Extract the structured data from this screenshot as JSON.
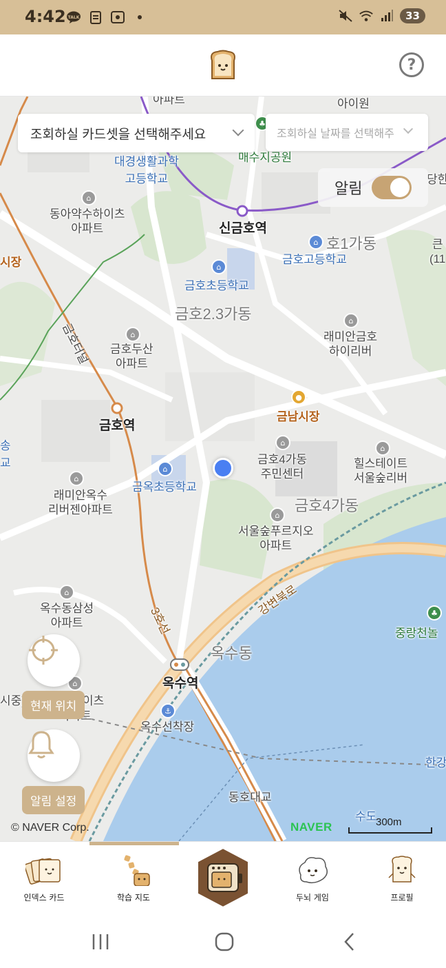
{
  "status_bar": {
    "time": "4:42",
    "battery": "33",
    "icons_left": [
      "talk-icon",
      "clipboard-icon",
      "screenshot-icon",
      "dot-icon"
    ],
    "icons_right": [
      "mute-icon",
      "wifi-icon",
      "signal-icon"
    ],
    "bg_color": "#d7bf97"
  },
  "header": {
    "logo": "toast-logo-icon",
    "help_label": "?"
  },
  "filters": {
    "cardset_placeholder": "조회하실 카드셋을 선택해주세요",
    "date_placeholder": "조회하실 날짜를 선택해주"
  },
  "alarm_toggle": {
    "label": "알림",
    "on": true
  },
  "map": {
    "labels": {
      "apt_top": "아파트",
      "aiwon": "아이원",
      "daegyeong": "대경생활과학\n고등학교",
      "maesu": "매수지공원",
      "dongah": "동아약수하이츠\n아파트",
      "singeum": "신금호역",
      "ho1": "호1가동",
      "geumho_hs": "금호고등학교",
      "sijang_left": "시장",
      "geumho_es": "금호초등학교",
      "ho23": "금호2.3가동",
      "tunnel": "금호터널",
      "geumho_doosan": "금호두산\n아파트",
      "raemian_geumho": "래미안금호\n하이리버",
      "geumnam": "금남시장",
      "geumho_stn": "금호역",
      "geumho4_center": "금호4가동\n주민센터",
      "hills": "힐스테이트\n서울숲리버",
      "geumok_es": "금옥초등학교",
      "raemian_oksu": "래미안옥수\n리버젠아파트",
      "ho4": "금호4가동",
      "seoulsup": "서울숲푸르지오\n아파트",
      "gangbyeon": "강변북로",
      "line3": "3호선",
      "oksu_samsung": "옥수동삼성\n아파트",
      "jungnang": "중랑천놀",
      "oksudong": "옥수동",
      "oksu_stn": "옥수역",
      "oksu_ferry": "옥수선착장",
      "dongho": "동호대교",
      "hangang": "한강",
      "sudo": "수도",
      "apt_heights": "이츠",
      "apt_heights2": "아파트",
      "soong_left": "송\n교",
      "dang": "당한",
      "keun": "큰\n(11",
      "sijung": "시중)"
    },
    "credit": "© NAVER Corp.",
    "naver": "NAVER",
    "scale": "300m"
  },
  "controls": {
    "current_location": "현재 위치",
    "alarm_settings": "알림 설정"
  },
  "bottom_nav": {
    "items": [
      {
        "label": "인덱스 카드",
        "icon": "index-card-icon"
      },
      {
        "label": "학습 지도",
        "icon": "learning-map-icon"
      },
      {
        "label": "",
        "icon": "toaster-center-icon"
      },
      {
        "label": "두뇌 게임",
        "icon": "brain-game-icon"
      },
      {
        "label": "프로필",
        "icon": "profile-icon"
      }
    ],
    "active_index": 1
  },
  "system_nav": [
    "recent-apps-icon",
    "home-icon",
    "back-icon"
  ]
}
